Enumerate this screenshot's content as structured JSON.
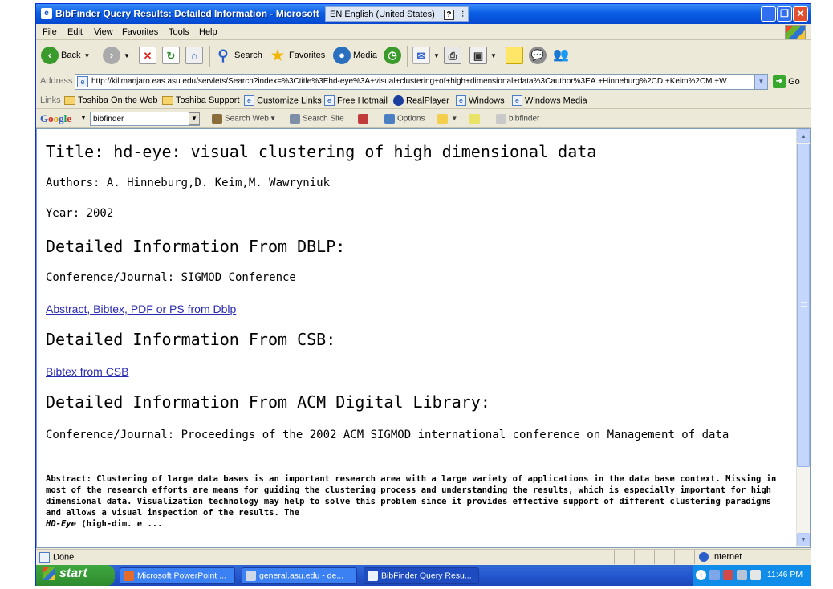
{
  "window": {
    "title": "BibFinder Query Results: Detailed Information - Microsoft",
    "lang_indicator": "EN English (United States)",
    "lang_help": "?",
    "lang_sep": "⁝"
  },
  "menu": [
    "File",
    "Edit",
    "View",
    "Favorites",
    "Tools",
    "Help"
  ],
  "toolbar": {
    "back": "Back",
    "search": "Search",
    "favorites": "Favorites",
    "media": "Media"
  },
  "address": {
    "label": "Address",
    "url": "http://kilimanjaro.eas.asu.edu/servlets/Search?index=%3Ctitle%3Ehd-eye%3A+visual+clustering+of+high+dimensional+data%3Cauthor%3EA.+Hinneburg%2CD.+Keim%2CM.+W",
    "go": "Go"
  },
  "links": {
    "label": "Links",
    "items": [
      "Toshiba On the Web",
      "Toshiba Support",
      "Customize Links",
      "Free Hotmail",
      "RealPlayer",
      "Windows",
      "Windows Media"
    ]
  },
  "google": {
    "query": "bibfinder",
    "search_web": "Search Web",
    "search_site": "Search Site",
    "options": "Options",
    "highlight_term": "bibfinder"
  },
  "page": {
    "title": "Title: hd-eye: visual clustering of high dimensional data",
    "authors": "Authors: A. Hinneburg,D. Keim,M. Wawryniuk",
    "year": "Year: 2002",
    "dblp_heading": "Detailed Information From DBLP:",
    "dblp_conf": "Conference/Journal: SIGMOD Conference",
    "dblp_link": "Abstract, Bibtex, PDF or PS from Dblp",
    "csb_heading": "Detailed Information From CSB:",
    "csb_link": "Bibtex from CSB",
    "acm_heading": "Detailed Information From ACM Digital Library:",
    "acm_conf": "Conference/Journal: Proceedings of the 2002 ACM SIGMOD international conference on Management of data",
    "abstract_before": "Abstract: Clustering of large data bases is an important research area with a large variety of applications in the data base context. Missing in most of the research efforts are means for guiding the clustering process and understanding the results, which is especially important for high dimensional data. Visualization technology may help to solve this problem since it provides effective support of different clustering paradigms and allows a visual inspection of the results. The",
    "abstract_em": "HD-Eye",
    "abstract_after": "(high-dim. e ..."
  },
  "status": {
    "text": "Done",
    "zone": "Internet"
  },
  "taskbar": {
    "start": "start",
    "tasks": [
      "Microsoft PowerPoint ...",
      "general.asu.edu - de...",
      "BibFinder Query Resu..."
    ],
    "clock": "11:46 PM"
  }
}
